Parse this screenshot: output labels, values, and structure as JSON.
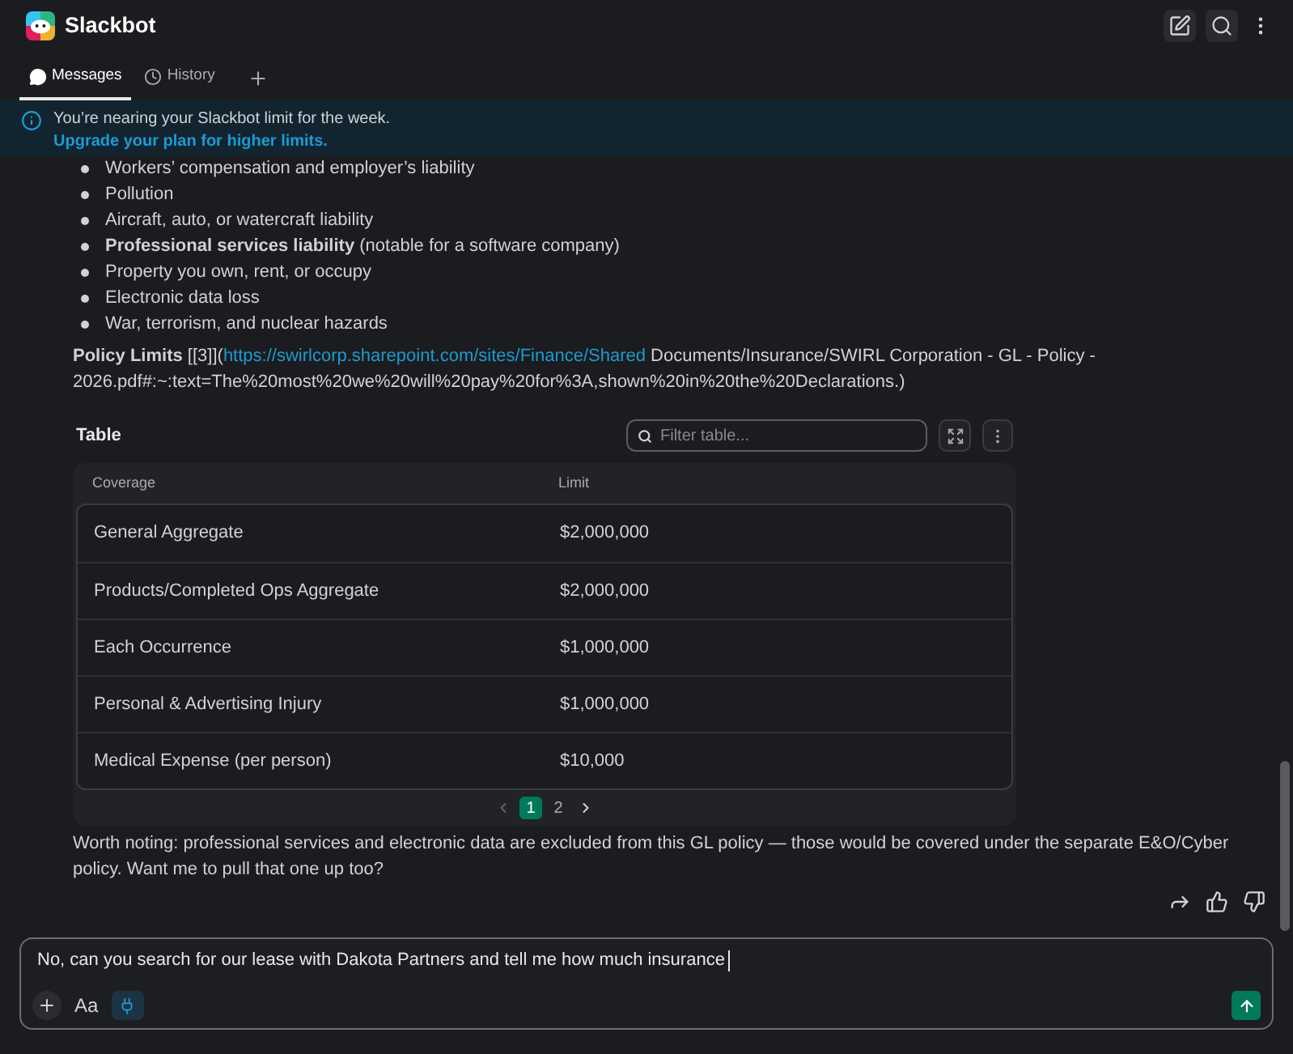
{
  "header": {
    "title": "Slackbot"
  },
  "tabs": [
    {
      "label": "Messages",
      "selected": true
    },
    {
      "label": "History",
      "selected": false
    }
  ],
  "banner": {
    "message": "You’re nearing your Slackbot limit for the week.",
    "link": "Upgrade your plan for higher limits."
  },
  "message": {
    "bullets": [
      "Workers’ compensation and employer’s liability",
      "Pollution",
      "Aircraft, auto, or watercraft liability",
      "**Professional services liability** (notable for a software company)",
      "Property you own, rent, or occupy",
      "Electronic data loss",
      "War, terrorism, and nuclear hazards"
    ],
    "policy_limits": {
      "label": "Policy Limits",
      "prefix": "[[3]](",
      "link": "https://swirlcorp.sharepoint.com/sites/Finance/Shared",
      "suffix": " Documents/Insurance/SWIRL Corporation - GL - Policy - 2026.pdf#:~:text=The%20most%20we%20will%20pay%20for%3A,shown%20in%20the%20Declarations.)"
    },
    "table": {
      "title": "Table",
      "filter": {
        "placeholder": "Filter table..."
      },
      "columns": [
        "Coverage",
        "Limit"
      ],
      "rows": [
        [
          "General Aggregate",
          "$2,000,000"
        ],
        [
          "Products/Completed Ops Aggregate",
          "$2,000,000"
        ],
        [
          "Each Occurrence",
          "$1,000,000"
        ],
        [
          "Personal & Advertising Injury",
          "$1,000,000"
        ],
        [
          "Medical Expense (per person)",
          "$10,000"
        ]
      ],
      "pager": {
        "prev_disabled": true,
        "next_disabled": false,
        "pages": [
          {
            "label": "1",
            "selected": true
          },
          {
            "label": "2",
            "selected": false
          }
        ]
      }
    },
    "note": "Worth noting: professional services and electronic data are excluded from this GL policy — those would be covered under the separate E&O/Cyber policy. Want me to pull that one up too?"
  },
  "composer": {
    "value": "No, can you search for our lease with Dakota Partners and tell me how much insurance",
    "format_label": "Aa",
    "tool_toggle": {
      "on": true
    }
  }
}
